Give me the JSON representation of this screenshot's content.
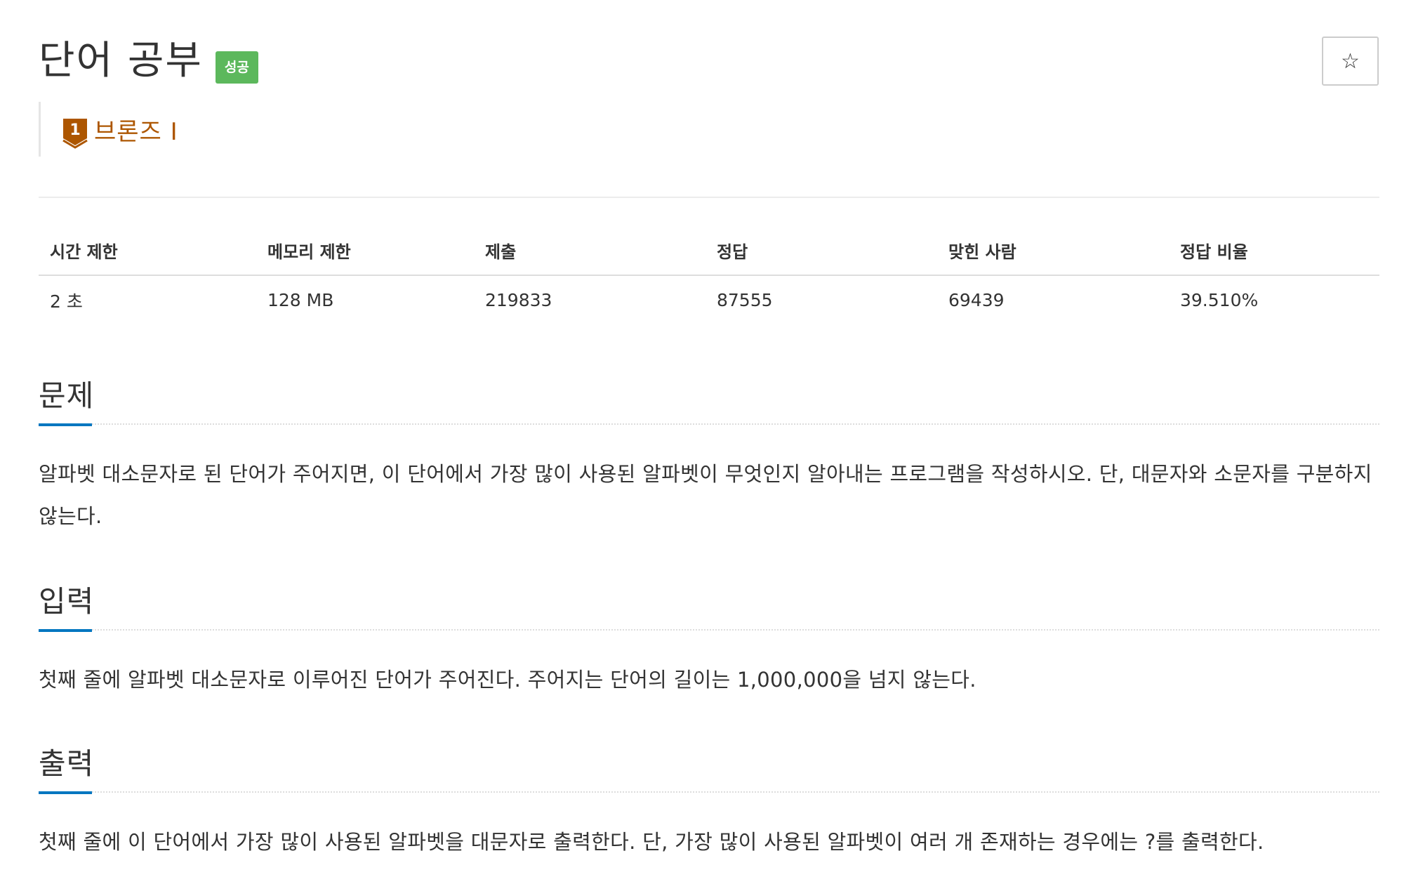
{
  "problem": {
    "title": "단어 공부",
    "status_badge": "성공",
    "star_icon": "☆",
    "tier": {
      "number": "1",
      "label": "브론즈 I",
      "color": "#ad5600"
    }
  },
  "info_table": {
    "headers": [
      "시간 제한",
      "메모리 제한",
      "제출",
      "정답",
      "맞힌 사람",
      "정답 비율"
    ],
    "values": [
      "2 초",
      "128 MB",
      "219833",
      "87555",
      "69439",
      "39.510%"
    ]
  },
  "sections": {
    "problem": {
      "heading": "문제",
      "text": "알파벳 대소문자로 된 단어가 주어지면, 이 단어에서 가장 많이 사용된 알파벳이 무엇인지 알아내는 프로그램을 작성하시오. 단, 대문자와 소문자를 구분하지 않는다."
    },
    "input": {
      "heading": "입력",
      "text": "첫째 줄에 알파벳 대소문자로 이루어진 단어가 주어진다. 주어지는 단어의 길이는 1,000,000을 넘지 않는다."
    },
    "output": {
      "heading": "출력",
      "text": "첫째 줄에 이 단어에서 가장 많이 사용된 알파벳을 대문자로 출력한다. 단, 가장 많이 사용된 알파벳이 여러 개 존재하는 경우에는 ?를 출력한다."
    }
  },
  "colors": {
    "badge_success": "#5cb85c",
    "section_underline": "#0076c0",
    "tier_bronze": "#ad5600"
  }
}
